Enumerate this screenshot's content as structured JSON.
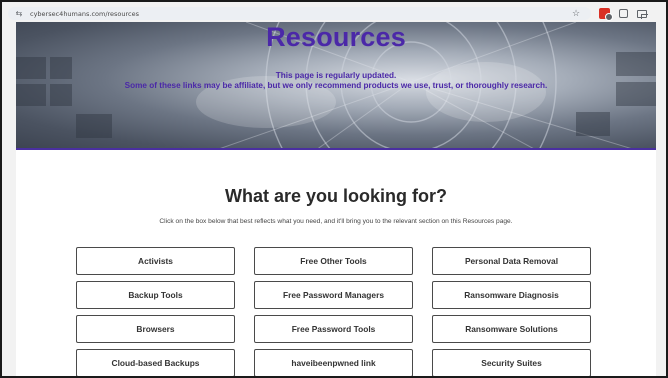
{
  "browser": {
    "url": "cybersec4humans.com/resources",
    "icons": [
      "site-settings-icon",
      "bookmark-star-icon",
      "extension-icon",
      "puzzle-extensions-icon",
      "tab-search-icon"
    ]
  },
  "hero": {
    "title": "Resources",
    "line1": "This page is regularly updated.",
    "line2": "Some of these links may be affiliate, but we only recommend products we use, trust, or thoroughly research."
  },
  "main": {
    "heading": "What are you looking for?",
    "instructions": "Click on the box below that best reflects what you need, and it'll bring you to the relevant section on this Resources page.",
    "categories": [
      "Activists",
      "Free Other Tools",
      "Personal Data Removal",
      "Backup Tools",
      "Free Password Managers",
      "Ransomware Diagnosis",
      "Browsers",
      "Free Password Tools",
      "Ransomware Solutions",
      "Cloud-based Backups",
      "haveibeenpwned link",
      "Security Suites"
    ]
  },
  "colors": {
    "accent_purple": "#4b28a8",
    "button_border": "#4a4a4a"
  }
}
